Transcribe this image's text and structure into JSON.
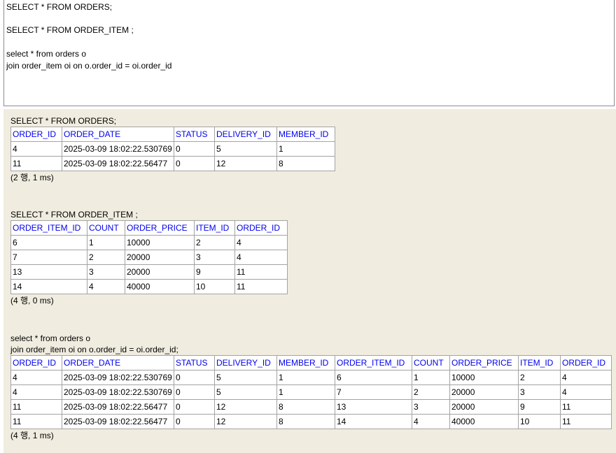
{
  "editor": {
    "lines": [
      "SELECT * FROM ORDERS;",
      "SELECT * FROM ORDER_ITEM ;",
      "select * from orders o",
      "join order_item oi on o.order_id = oi.order_id"
    ]
  },
  "results": [
    {
      "query_lines": [
        "SELECT * FROM ORDERS;"
      ],
      "columns": [
        "ORDER_ID",
        "ORDER_DATE",
        "STATUS",
        "DELIVERY_ID",
        "MEMBER_ID"
      ],
      "rows": [
        [
          "4",
          "2025-03-09 18:02:22.530769",
          "0",
          "5",
          "1"
        ],
        [
          "11",
          "2025-03-09 18:02:22.56477",
          "0",
          "12",
          "8"
        ]
      ],
      "status": "(2 행, 1 ms)"
    },
    {
      "query_lines": [
        "SELECT * FROM ORDER_ITEM ;"
      ],
      "columns": [
        "ORDER_ITEM_ID",
        "COUNT",
        "ORDER_PRICE",
        "ITEM_ID",
        "ORDER_ID"
      ],
      "rows": [
        [
          "6",
          "1",
          "10000",
          "2",
          "4"
        ],
        [
          "7",
          "2",
          "20000",
          "3",
          "4"
        ],
        [
          "13",
          "3",
          "20000",
          "9",
          "11"
        ],
        [
          "14",
          "4",
          "40000",
          "10",
          "11"
        ]
      ],
      "status": "(4 행, 0 ms)"
    },
    {
      "query_lines": [
        "select * from orders o",
        "join order_item oi on o.order_id = oi.order_id;"
      ],
      "columns": [
        "ORDER_ID",
        "ORDER_DATE",
        "STATUS",
        "DELIVERY_ID",
        "MEMBER_ID",
        "ORDER_ITEM_ID",
        "COUNT",
        "ORDER_PRICE",
        "ITEM_ID",
        "ORDER_ID"
      ],
      "rows": [
        [
          "4",
          "2025-03-09 18:02:22.530769",
          "0",
          "5",
          "1",
          "6",
          "1",
          "10000",
          "2",
          "4"
        ],
        [
          "4",
          "2025-03-09 18:02:22.530769",
          "0",
          "5",
          "1",
          "7",
          "2",
          "20000",
          "3",
          "4"
        ],
        [
          "11",
          "2025-03-09 18:02:22.56477",
          "0",
          "12",
          "8",
          "13",
          "3",
          "20000",
          "9",
          "11"
        ],
        [
          "11",
          "2025-03-09 18:02:22.56477",
          "0",
          "12",
          "8",
          "14",
          "4",
          "40000",
          "10",
          "11"
        ]
      ],
      "status": "(4 행, 1 ms)"
    }
  ]
}
